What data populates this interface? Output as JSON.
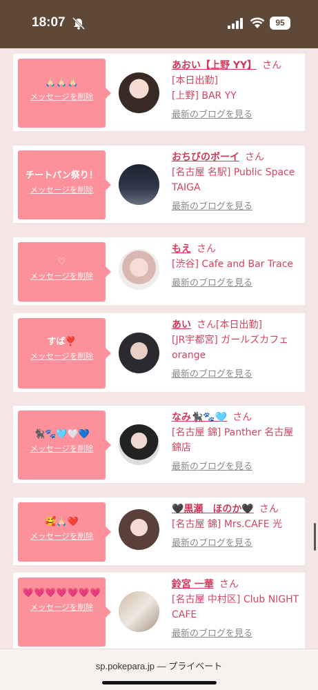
{
  "status_bar": {
    "time": "18:07",
    "battery": "95"
  },
  "cards": [
    {
      "message": "🙏🏻🙏🏻🙏🏻",
      "delete_label": "メッセージを削除",
      "name": "あおい【上野 YY】",
      "san": "さん",
      "line1": "[本日出勤]",
      "line2": "[上野] BAR YY",
      "blog_label": "最新のブログを見る",
      "avatar_icon": "portrait-photo"
    },
    {
      "message": "チートパン祭り！",
      "delete_label": "メッセージを削除",
      "name": "おちびのボーイ",
      "san": "さん",
      "line1": "[名古屋 名駅] Public Space TAIGA",
      "line2": "",
      "blog_label": "最新のブログを見る",
      "avatar_icon": "night-photo"
    },
    {
      "message": "♡",
      "delete_label": "メッセージを削除",
      "name": "もえ",
      "san": "さん",
      "line1": "[渋谷] Cafe and Bar Trace",
      "line2": "",
      "blog_label": "最新のブログを見る",
      "avatar_icon": "portrait-photo"
    },
    {
      "message": "すば❣️",
      "delete_label": "メッセージを削除",
      "name": "あい",
      "san": "さん[本日出勤]",
      "line1": "[JR宇都宮] ガールズカフェorange",
      "line2": "",
      "blog_label": "最新のブログを見る",
      "avatar_icon": "portrait-photo"
    },
    {
      "message": "🐈‍⬛🐾🩵🤍💙",
      "delete_label": "メッセージを削除",
      "name": "なみ🐈‍⬛🐾🩵",
      "san": "さん",
      "line1": "[名古屋 錦] Panther 名古屋錦店",
      "line2": "",
      "blog_label": "最新のブログを見る",
      "avatar_icon": "portrait-photo"
    },
    {
      "message": "🥰🙏🏻❤️",
      "delete_label": "メッセージを削除",
      "name": "🖤黒瀬　ほのか🖤",
      "san": "さん",
      "line1": "[名古屋 錦] Mrs.CAFE 光",
      "line2": "",
      "blog_label": "最新のブログを見る",
      "avatar_icon": "portrait-photo"
    },
    {
      "message": "💗💗💗💗💗💗💗",
      "delete_label": "メッセージを削除",
      "name": "鈴宮 一華",
      "san": "さん",
      "line1": "[名古屋 中村区] Club NIGHT CAFE",
      "line2": "",
      "blog_label": "最新のブログを見る",
      "avatar_icon": "hands-photo"
    }
  ],
  "bottom_bar": {
    "url_text": "sp.pokepara.jp — プライベート"
  }
}
